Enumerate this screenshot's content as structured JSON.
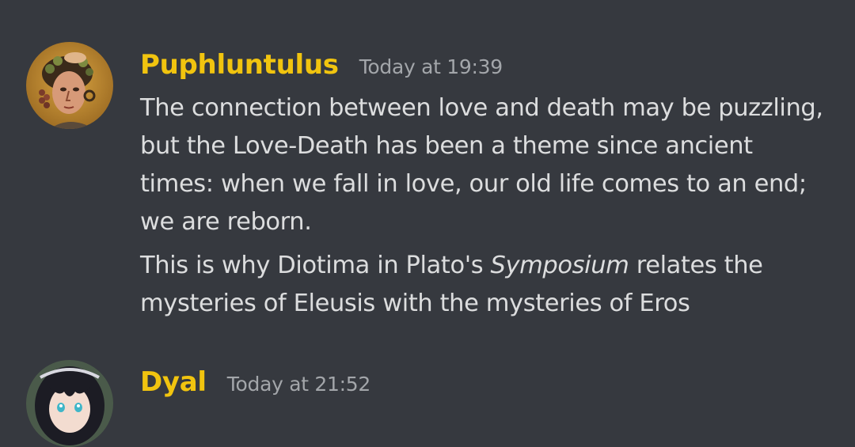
{
  "messages": [
    {
      "username": "Puphluntulus",
      "timestamp": "Today at 19:39",
      "username_color": "#f1c40f",
      "avatar_icon": "byzantine-mosaic-portrait-avatar",
      "paragraphs": [
        {
          "text": "The connection between love and death may be puzzling, but the Love-Death has been a theme since ancient times: when we fall in love, our old life comes to an end; we are reborn."
        },
        {
          "before": "This is why Diotima in Plato's ",
          "emphasis": "Symposium",
          "after": " relates the mysteries of Eleusis with the mysteries of Eros"
        }
      ]
    },
    {
      "username": "Dyal",
      "timestamp": "Today at 21:52",
      "username_color": "#f1c40f",
      "avatar_icon": "anime-girl-avatar"
    }
  ]
}
